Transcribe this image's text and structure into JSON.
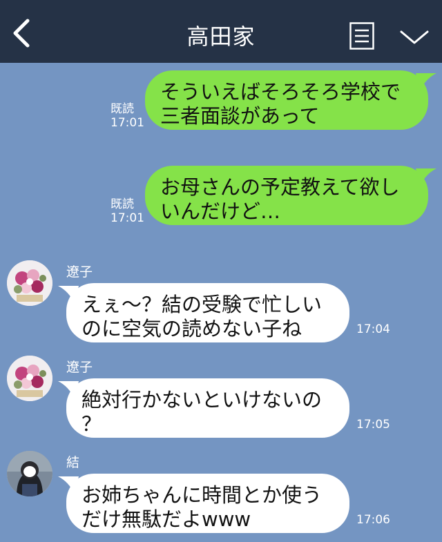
{
  "header": {
    "title": "高田家"
  },
  "messages_out": [
    {
      "text_lines": [
        "そういえばそろそろ学校で",
        "三者面談があって"
      ],
      "read_label": "既読",
      "time": "17:01"
    },
    {
      "text_lines": [
        "お母さんの予定教えて欲し",
        "いんだけど…"
      ],
      "read_label": "既読",
      "time": "17:01"
    }
  ],
  "messages_in": [
    {
      "sender": "遼子",
      "text_lines": [
        "えぇ〜？結の受験で忙しい",
        "のに空気の読めない子ね"
      ],
      "time": "17:04"
    },
    {
      "sender": "遼子",
      "text_lines": [
        "絶対行かないといけないの",
        "？"
      ],
      "time": "17:05"
    },
    {
      "sender": "結",
      "text_lines": [
        "お姉ちゃんに時間とか使う",
        "だけ無駄だよwww"
      ],
      "time": "17:06"
    }
  ],
  "colors": {
    "header_bg": "#253246",
    "chat_bg": "#7495c2",
    "outgoing_bubble": "#85e249",
    "incoming_bubble": "#ffffff"
  },
  "icons": {
    "back": "chevron-left-icon",
    "menu": "note-list-icon",
    "expand": "chevron-down-icon"
  }
}
